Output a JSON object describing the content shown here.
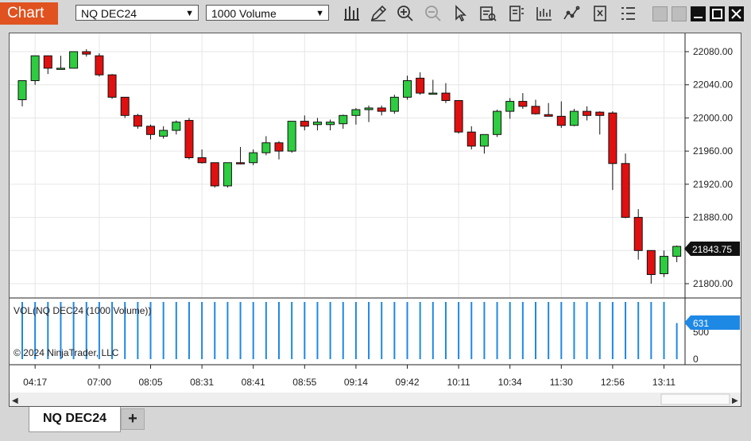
{
  "app": {
    "title": "Chart"
  },
  "toolbar": {
    "instrument": "NQ DEC24",
    "period": "1000 Volume",
    "tools": [
      "bar-type-icon",
      "pencil-draw-icon",
      "zoom-in-icon",
      "zoom-out-icon",
      "pointer-icon",
      "data-box-icon",
      "properties-icon",
      "strategies-icon",
      "indicators-icon",
      "chart-trader-icon",
      "templates-icon"
    ]
  },
  "chart": {
    "price_labels": [
      "22080.00",
      "22040.00",
      "22000.00",
      "21960.00",
      "21920.00",
      "21880.00",
      "21800.00"
    ],
    "last_price": "21843.75",
    "volume_title": "VOL(NQ DEC24 (1000 Volume))",
    "volume_axis": [
      "500",
      "0"
    ],
    "volume_last": "631",
    "copyright": "© 2024 NinjaTrader, LLC",
    "time_labels": [
      "04:17",
      "07:00",
      "08:05",
      "08:31",
      "08:41",
      "08:55",
      "09:14",
      "09:42",
      "10:11",
      "10:34",
      "11:30",
      "12:56",
      "13:11"
    ],
    "colors": {
      "up": "#2ecc40",
      "down": "#e01010",
      "volume": "#1e88e5"
    }
  },
  "chart_data": {
    "type": "candlestick",
    "y_range": [
      21790,
      22100
    ],
    "volume_range": [
      0,
      1000
    ],
    "series": [
      {
        "name": "NQ DEC24",
        "ohlc": [
          [
            22022,
            22045,
            22014,
            22045
          ],
          [
            22045,
            22075,
            22040,
            22075
          ],
          [
            22075,
            22075,
            22053,
            22060
          ],
          [
            22060,
            22075,
            22060,
            22060
          ],
          [
            22060,
            22080,
            22060,
            22080
          ],
          [
            22080,
            22083,
            22074,
            22077
          ],
          [
            22075,
            22078,
            22050,
            22052
          ],
          [
            22052,
            22053,
            22023,
            22025
          ],
          [
            22025,
            22025,
            22000,
            22003
          ],
          [
            22003,
            22005,
            21987,
            21990
          ],
          [
            21990,
            21992,
            21974,
            21980
          ],
          [
            21978,
            21990,
            21975,
            21985
          ],
          [
            21985,
            21997,
            21980,
            21995
          ],
          [
            21997,
            22000,
            21950,
            21952
          ],
          [
            21952,
            21962,
            21945,
            21946
          ],
          [
            21946,
            21946,
            21916,
            21918
          ],
          [
            21918,
            21946,
            21916,
            21946
          ],
          [
            21946,
            21965,
            21944,
            21945
          ],
          [
            21946,
            21962,
            21943,
            21958
          ],
          [
            21958,
            21978,
            21955,
            21970
          ],
          [
            21970,
            21972,
            21950,
            21960
          ],
          [
            21960,
            21996,
            21958,
            21996
          ],
          [
            21996,
            22003,
            21985,
            21990
          ],
          [
            21992,
            22000,
            21985,
            21995
          ],
          [
            21992,
            21998,
            21985,
            21995
          ],
          [
            21993,
            22004,
            21987,
            22003
          ],
          [
            22003,
            22012,
            21992,
            22010
          ],
          [
            22010,
            22015,
            21995,
            22012
          ],
          [
            22012,
            22015,
            22003,
            22008
          ],
          [
            22008,
            22028,
            22005,
            22025
          ],
          [
            22025,
            22051,
            22022,
            22045
          ],
          [
            22048,
            22055,
            22028,
            22030
          ],
          [
            22030,
            22046,
            22029,
            22030
          ],
          [
            22030,
            22042,
            22018,
            22021
          ],
          [
            22021,
            22021,
            21981,
            21983
          ],
          [
            21983,
            21990,
            21962,
            21966
          ],
          [
            21966,
            21980,
            21957,
            21980
          ],
          [
            21980,
            22010,
            21977,
            22008
          ],
          [
            22008,
            22024,
            21999,
            22020
          ],
          [
            22020,
            22030,
            22011,
            22014
          ],
          [
            22014,
            22022,
            22004,
            22005
          ],
          [
            22004,
            22018,
            22002,
            22002
          ],
          [
            22002,
            22020,
            21988,
            21991
          ],
          [
            21991,
            22011,
            21990,
            22008
          ],
          [
            22008,
            22014,
            21997,
            22003
          ],
          [
            22007,
            22008,
            21980,
            22003
          ],
          [
            22006,
            22008,
            21913,
            21945
          ],
          [
            21945,
            21957,
            21879,
            21880
          ],
          [
            21880,
            21890,
            21829,
            21840
          ],
          [
            21840,
            21840,
            21800,
            21811
          ],
          [
            21812,
            21840,
            21808,
            21833
          ],
          [
            21833,
            21846,
            21826,
            21845
          ]
        ]
      },
      {
        "name": "VOL",
        "values": [
          1000,
          1000,
          1000,
          1000,
          1000,
          1000,
          1000,
          1000,
          1000,
          1000,
          1000,
          1000,
          1000,
          1000,
          1000,
          1000,
          1000,
          1000,
          1000,
          1000,
          1000,
          1000,
          1000,
          1000,
          1000,
          1000,
          1000,
          1000,
          1000,
          1000,
          1000,
          1000,
          1000,
          1000,
          1000,
          1000,
          1000,
          1000,
          1000,
          1000,
          1000,
          1000,
          1000,
          1000,
          1000,
          1000,
          1000,
          1000,
          1000,
          1000,
          1000,
          631
        ]
      }
    ]
  }
}
